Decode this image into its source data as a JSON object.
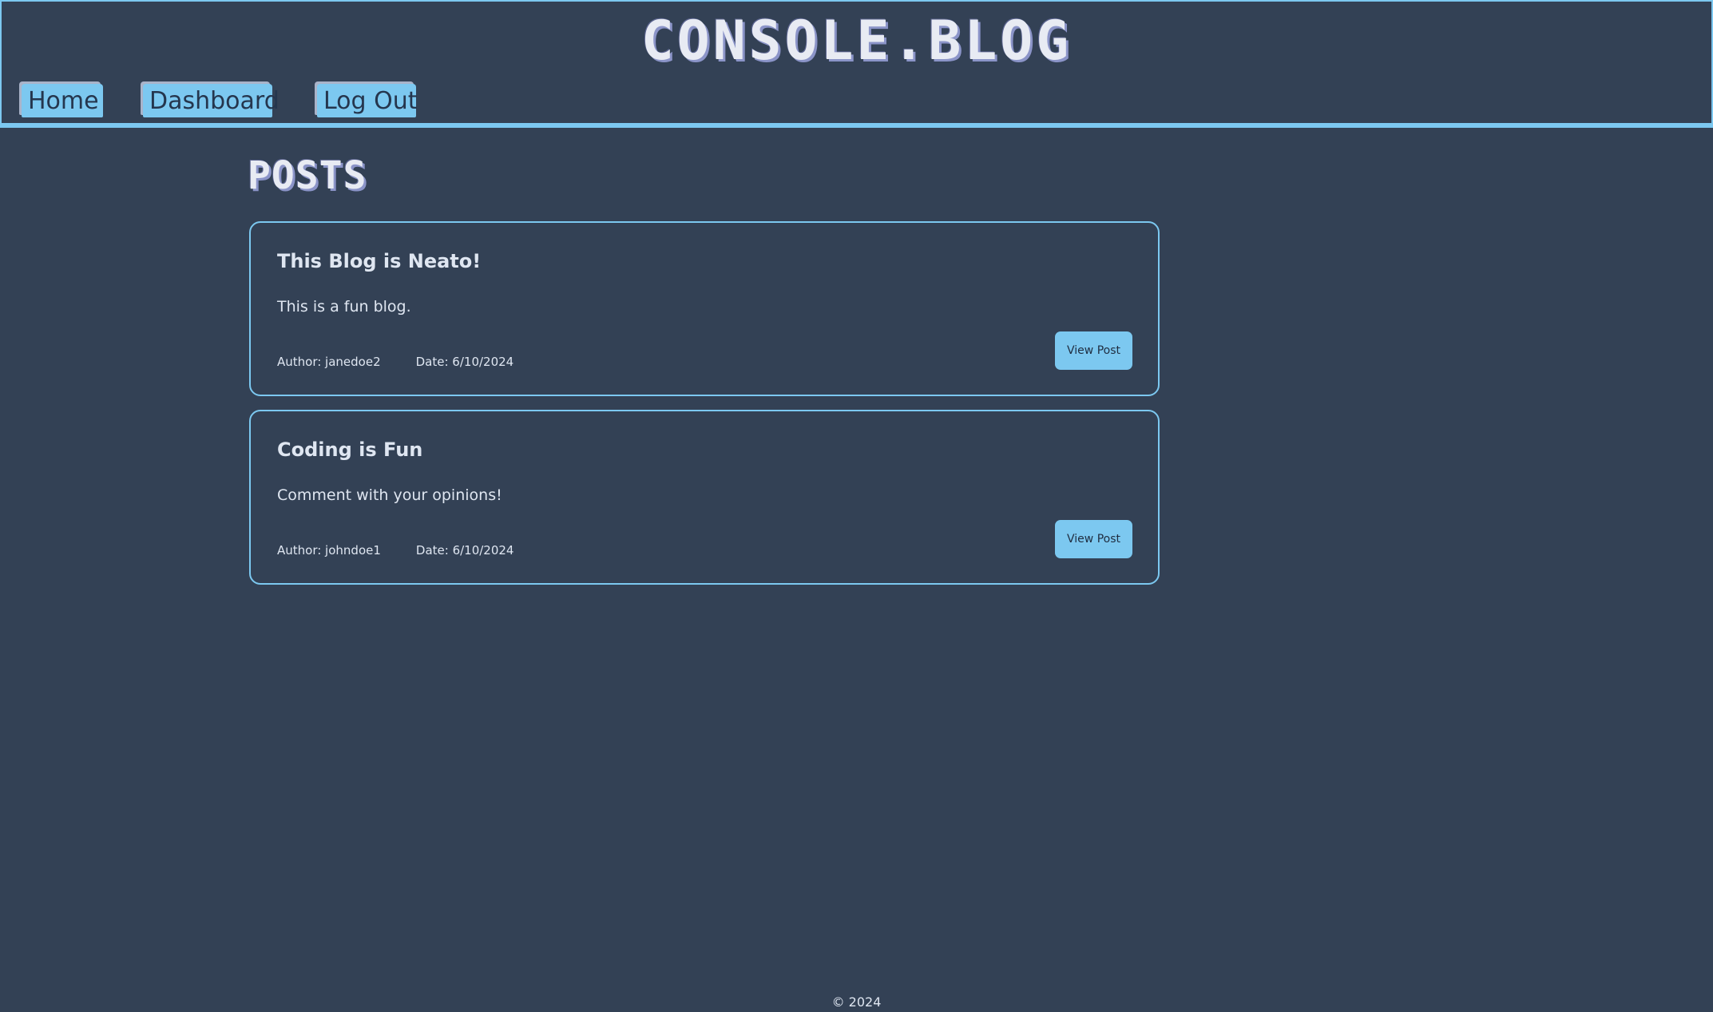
{
  "header": {
    "site_title": "CONSOLE.BLOG",
    "nav": [
      {
        "label": "Home"
      },
      {
        "label": "Dashboard"
      },
      {
        "label": "Log Out"
      }
    ]
  },
  "main": {
    "section_title": "POSTS",
    "posts": [
      {
        "title": "This Blog is Neato!",
        "body": "This is a fun blog.",
        "author": "Author: janedoe2",
        "date": "Date: 6/10/2024",
        "button_label": "View Post"
      },
      {
        "title": "Coding is Fun",
        "body": "Comment with your opinions!",
        "author": "Author: johndoe1",
        "date": "Date: 6/10/2024",
        "button_label": "View Post"
      }
    ]
  },
  "footer": {
    "copyright": "© 2024"
  },
  "colors": {
    "background": "#334155",
    "accent": "#7cc8f0",
    "text": "#dfe6f1"
  }
}
